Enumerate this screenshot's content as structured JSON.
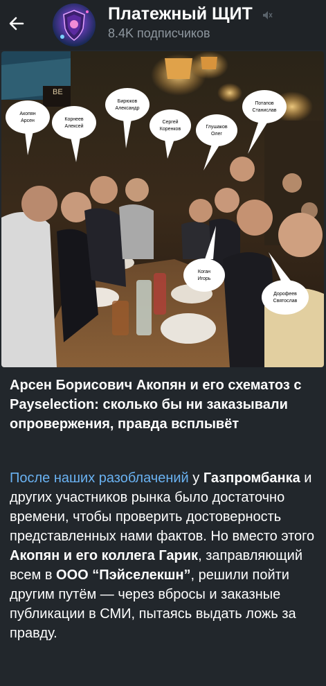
{
  "header": {
    "back_icon": "arrow-left-icon",
    "channel_title": "Платежный ЩИТ",
    "muted_icon": "speaker-muted-icon",
    "subscribers": "8.4K подписчиков"
  },
  "photo": {
    "sign_fragment": "BE",
    "labels": [
      "Акопян\nАрсен",
      "Корнеев\nАлексей",
      "Бирюков\nАлександр",
      "Сергей\nКоренков",
      "Глушаков\nОлег",
      "Потапов\nСтанислав",
      "Коган\nИгорь",
      "Дорофеев\nСвятослав"
    ]
  },
  "post": {
    "headline": "Арсен Борисович Акопян и его схематоз с Payselection: сколько бы ни заказывали опровержения, правда всплывёт",
    "body": {
      "link_text": "После наших разоблачений",
      "t1": " у ",
      "b1": "Газпромбанка",
      "t2": " и других участников рынка было достаточно времени, чтобы проверить достоверность представленных нами фактов. Но вместо этого ",
      "b2": "Акопян и его коллега Гарик",
      "t3": ", заправляющий всем в ",
      "b3": "ООО “Пэйселекшн”",
      "t4": ", решили пойти другим путём — через вбросы и заказные публикации в СМИ, пытаясь выдать ложь за правду."
    }
  },
  "colors": {
    "background": "#1f2327",
    "link": "#6ab2f2",
    "subtitle": "#8e979f"
  }
}
